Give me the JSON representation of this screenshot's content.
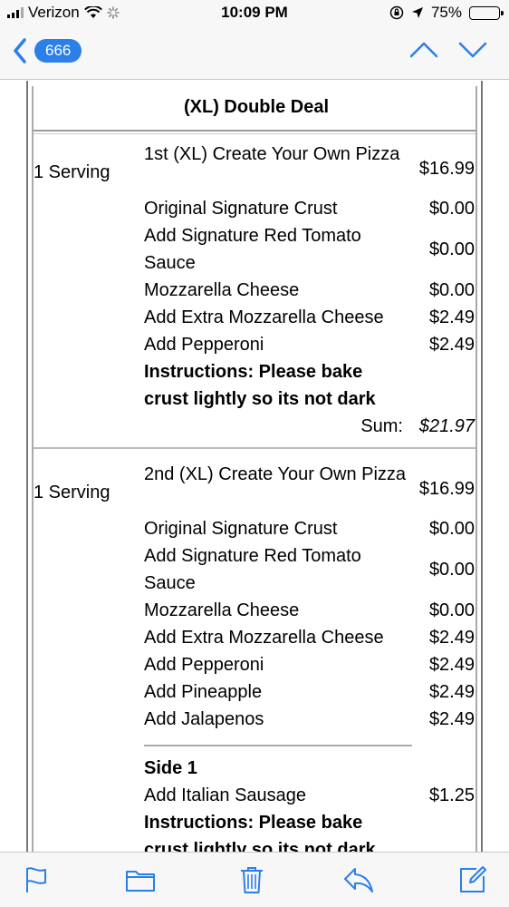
{
  "status_bar": {
    "carrier": "Verizon",
    "time": "10:09 PM",
    "battery": "75%",
    "battery_level": 0.75
  },
  "nav": {
    "back_count": "666"
  },
  "deal": {
    "title": "(XL) Double Deal",
    "items": [
      {
        "qty": "1  Serving",
        "lines": [
          {
            "text": "1st (XL) Create Your Own Pizza",
            "price": "$16.99"
          },
          {
            "text": "Original Signature Crust",
            "price": "$0.00"
          },
          {
            "text": "Add Signature Red Tomato Sauce",
            "price": "$0.00"
          },
          {
            "text": "Mozzarella Cheese",
            "price": "$0.00"
          },
          {
            "text": "Add Extra Mozzarella Cheese",
            "price": "$2.49"
          },
          {
            "text": "Add Pepperoni",
            "price": "$2.49"
          }
        ],
        "instructions": "Instructions: Please bake crust lightly so its not dark",
        "sum_label": "Sum:",
        "sum": "$21.97"
      },
      {
        "qty": "1  Serving",
        "lines": [
          {
            "text": "2nd (XL) Create Your Own Pizza",
            "price": "$16.99"
          },
          {
            "text": "Original Signature Crust",
            "price": "$0.00"
          },
          {
            "text": "Add Signature Red Tomato Sauce",
            "price": "$0.00"
          },
          {
            "text": "Mozzarella Cheese",
            "price": "$0.00"
          },
          {
            "text": "Add Extra Mozzarella Cheese",
            "price": "$2.49"
          },
          {
            "text": "Add Pepperoni",
            "price": "$2.49"
          },
          {
            "text": "Add Pineapple",
            "price": "$2.49"
          },
          {
            "text": "Add Jalapenos",
            "price": "$2.49"
          }
        ],
        "side_title": "Side 1",
        "side_lines": [
          {
            "text": "Add Italian Sausage",
            "price": "$1.25"
          }
        ],
        "instructions": "Instructions: Please bake crust lightly so its not dark"
      }
    ]
  },
  "toolbar": {
    "icons": [
      "flag-icon",
      "folder-icon",
      "trash-icon",
      "reply-icon",
      "compose-icon"
    ]
  },
  "colors": {
    "accent": "#2b7fe8",
    "bar_bg": "#f7f7f7"
  }
}
